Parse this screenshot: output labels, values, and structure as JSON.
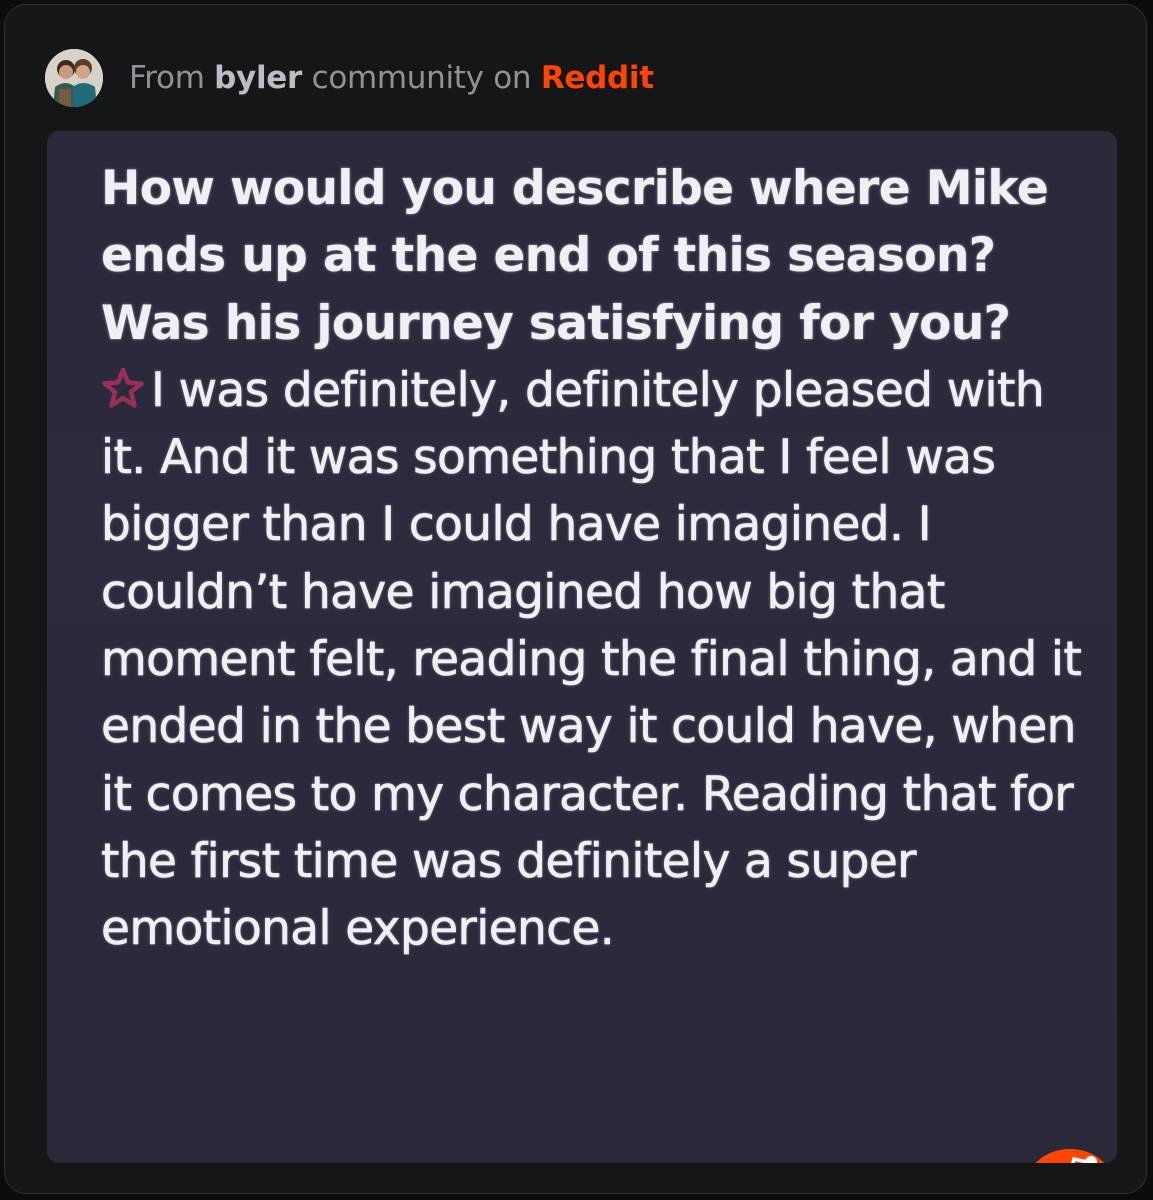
{
  "header": {
    "prefix": "From",
    "community": "byler",
    "middle": "community on",
    "platform": "Reddit"
  },
  "media": {
    "question": "How would you describe where Mike ends up at the end of this season? Was his journey satisfying for you?",
    "answer": "I was definitely, definitely pleased with it. And it was something that I feel was bigger than I could have imagined. I couldn’t have imagined how big that moment felt, reading the final thing, and it ended in the best way it could have, when it comes to my character. Reading that for the first time was definitely a super emotional experience."
  },
  "colors": {
    "brand": "#ff4500",
    "card_background": "#151618",
    "media_background": "#2a2a3c",
    "star": "#9b2d5b"
  },
  "icons": {
    "avatar": "community-avatar",
    "star": "star-icon",
    "badge": "reddit-snoo-icon"
  }
}
